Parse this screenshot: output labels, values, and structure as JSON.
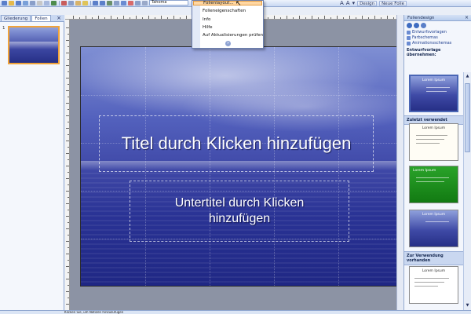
{
  "toolbar": {
    "font_name": "Tahoma",
    "design_label": "Design",
    "new_slide_label": "Neue Folie"
  },
  "left_pane": {
    "tabs": [
      "Gliederung",
      "Folien"
    ],
    "slide_number": "1"
  },
  "menu": {
    "highlighted_item": "Folienlayout...",
    "items": [
      "Folieneigenschaften",
      "Info",
      "Hilfe",
      "Auf Aktualisierungen prüfen"
    ],
    "more_glyph": "»"
  },
  "slide": {
    "title_placeholder": "Titel durch Klicken hinzufügen",
    "subtitle_placeholder": "Untertitel durch Klicken hinzufügen"
  },
  "task_pane": {
    "title": "Foliendesign",
    "links": [
      "Entwurfsvorlagen",
      "Farbschemas",
      "Animationsschemas"
    ],
    "section_apply": "Entwurfvorlage übernehmen:",
    "section_recent": "Zuletzt verwendet",
    "section_available": "Zur Verwendung vorhanden",
    "template_titles": [
      "Lorem Ipsum",
      "Lorem Ipsum",
      "Lorem Ipsum",
      "Lorem Ipsum",
      "Lorem Ipsum"
    ]
  },
  "statusbar": {
    "text": "Klicken Sie, um Notizen hinzuzufügen"
  },
  "colors": {
    "accent": "#4a66b5",
    "selection_orange": "#f0a33a",
    "slide_blue": "#3e47a6"
  }
}
